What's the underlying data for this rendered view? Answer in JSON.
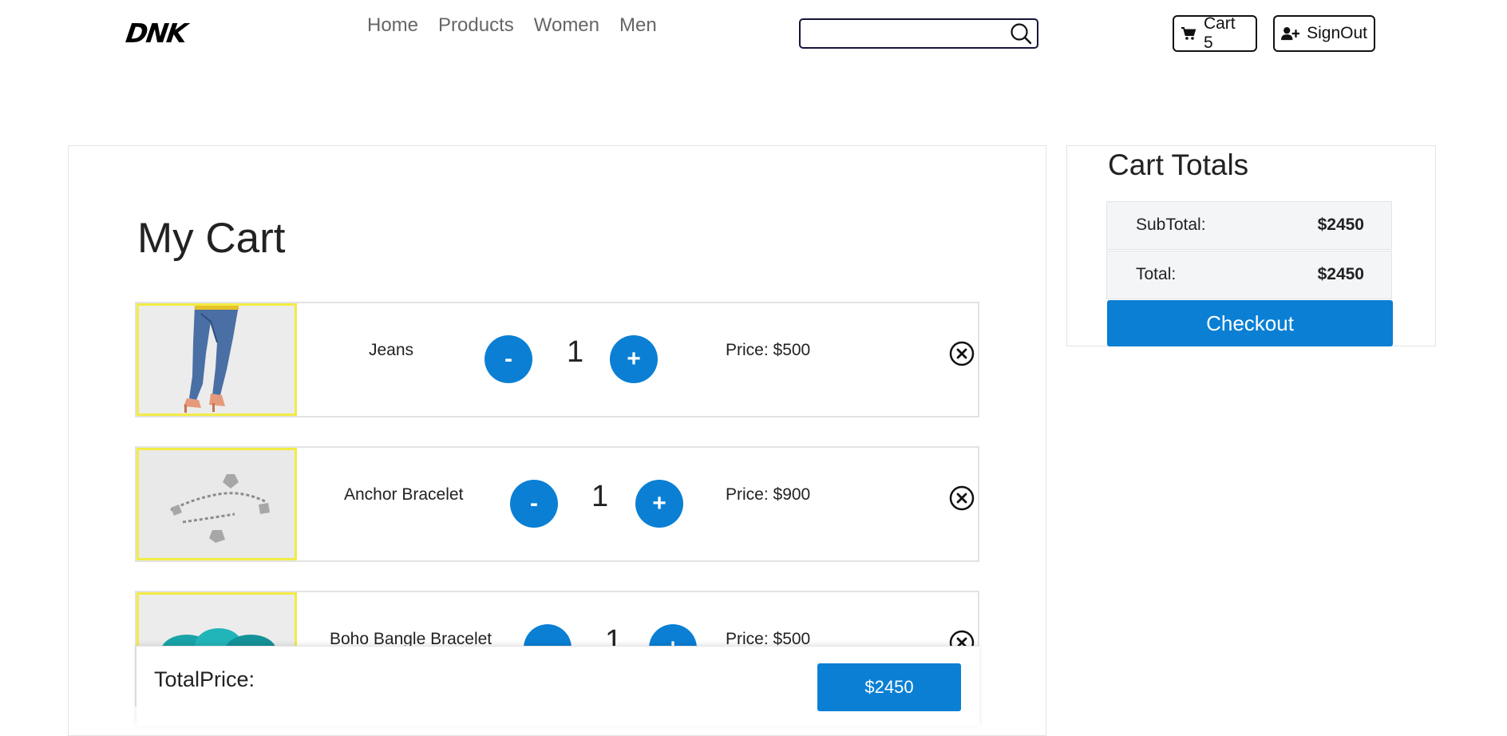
{
  "header": {
    "logo": "DNK",
    "nav": [
      "Home",
      "Products",
      "Women",
      "Men"
    ],
    "search": {
      "value": "",
      "placeholder": ""
    },
    "cart_label": "Cart 5",
    "signout_label": "SignOut"
  },
  "cart": {
    "title": "My Cart",
    "items": [
      {
        "name": "Jeans",
        "quantity": "1",
        "price": "Price: $500",
        "minus": "-",
        "plus": "+"
      },
      {
        "name": "Anchor Bracelet",
        "quantity": "1",
        "price": "Price: $900",
        "minus": "-",
        "plus": "+"
      },
      {
        "name": "Boho Bangle Bracelet",
        "quantity": "1",
        "price": "Price: $500",
        "minus": "-",
        "plus": "+"
      }
    ],
    "total_label": "TotalPrice:",
    "total_value": "$2450"
  },
  "totals": {
    "title": "Cart Totals",
    "subtotal_label": "SubTotal:",
    "subtotal_value": "$2450",
    "total_label": "Total:",
    "total_value": "$2450",
    "checkout_label": "Checkout"
  },
  "colors": {
    "accent": "#0a7fd4",
    "thumb_border": "#f2ec45"
  }
}
